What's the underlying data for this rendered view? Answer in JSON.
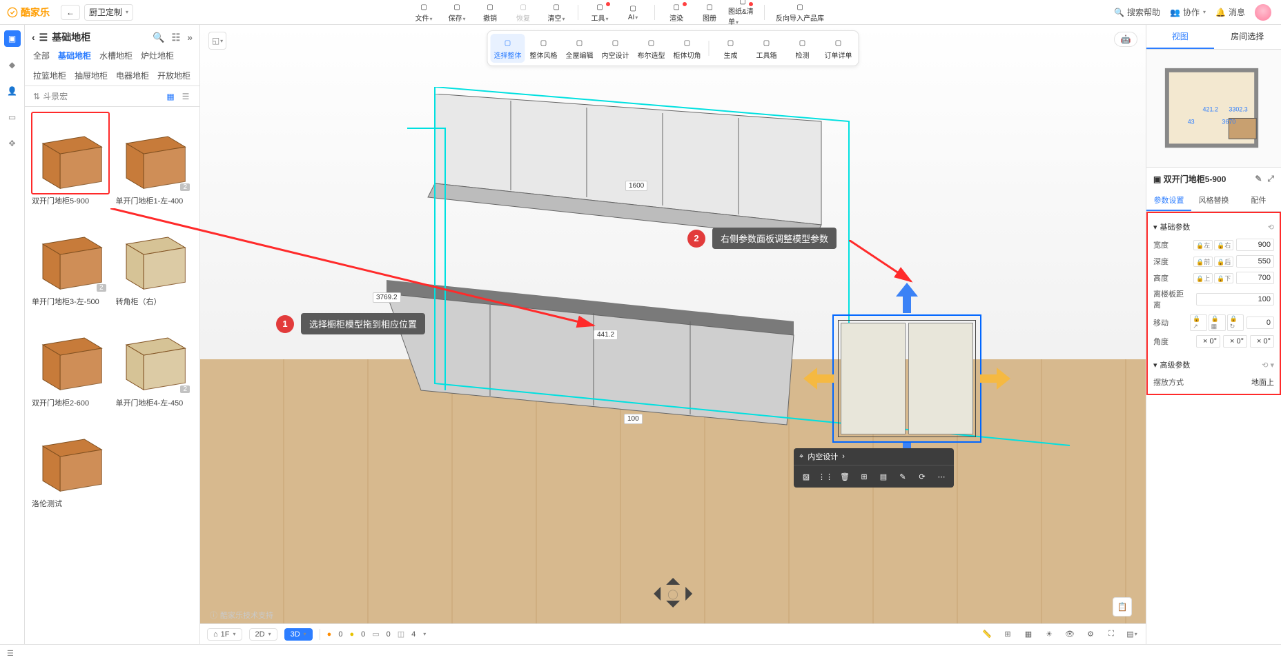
{
  "brand": "酷家乐",
  "mode": "厨卫定制",
  "top_tools": [
    {
      "id": "file",
      "label": "文件",
      "dot": false,
      "caret": true
    },
    {
      "id": "save",
      "label": "保存",
      "dot": false,
      "caret": true
    },
    {
      "id": "undo",
      "label": "撤销",
      "dot": false
    },
    {
      "id": "redo",
      "label": "恢复",
      "dot": false,
      "disabled": true
    },
    {
      "id": "clear",
      "label": "清空",
      "dot": false,
      "caret": true
    },
    {
      "id": "div",
      "label": "",
      "divider": true
    },
    {
      "id": "tools",
      "label": "工具",
      "dot": true,
      "caret": true
    },
    {
      "id": "ai",
      "label": "AI",
      "dot": false,
      "caret": true
    },
    {
      "id": "div2",
      "label": "",
      "divider": true
    },
    {
      "id": "render",
      "label": "渲染",
      "dot": true
    },
    {
      "id": "album",
      "label": "图册",
      "dot": false
    },
    {
      "id": "draw",
      "label": "图纸&清单",
      "dot": true,
      "caret": true
    },
    {
      "id": "div3",
      "label": "",
      "divider": true
    },
    {
      "id": "export",
      "label": "反向导入产品库",
      "dot": false,
      "wide": true
    }
  ],
  "top_right": {
    "search": "搜索帮助",
    "collab": "协作",
    "msg": "消息"
  },
  "rail": [
    "home",
    "deco",
    "user",
    "box",
    "puzzle"
  ],
  "catalog": {
    "title": "基础地柜",
    "tabs_row1": [
      "全部",
      "基础地柜",
      "水槽地柜",
      "炉灶地柜"
    ],
    "tabs_row2": [
      "拉篮地柜",
      "抽屉地柜",
      "电器地柜",
      "开放地柜"
    ],
    "active_tab": "基础地柜",
    "filter_label": "斗景宏",
    "items": [
      {
        "name": "双开门地柜5-900",
        "badge": "",
        "sel": true,
        "col": "#c77b3a"
      },
      {
        "name": "单开门地柜1-左-400",
        "badge": "2",
        "col": "#c77b3a"
      },
      {
        "name": "单开门地柜3-左-500",
        "badge": "2",
        "col": "#c77b3a"
      },
      {
        "name": "转角柜（右）",
        "badge": "",
        "col": "#d6c396"
      },
      {
        "name": "双开门地柜2-600",
        "badge": "",
        "col": "#c77b3a"
      },
      {
        "name": "单开门地柜4-左-450",
        "badge": "2",
        "col": "#d6c396"
      },
      {
        "name": "洛伦测试",
        "badge": "",
        "col": "#c77b3a"
      },
      {
        "name": "",
        "badge": "",
        "col": "",
        "empty": true
      }
    ]
  },
  "view_tools": [
    {
      "id": "select",
      "label": "选择整体",
      "active": true
    },
    {
      "id": "style",
      "label": "整体风格"
    },
    {
      "id": "edit",
      "label": "全屋编辑"
    },
    {
      "id": "interior",
      "label": "内空设计"
    },
    {
      "id": "profile",
      "label": "布尔造型"
    },
    {
      "id": "edge",
      "label": "柜体切角"
    },
    {
      "id": "div",
      "divider": true
    },
    {
      "id": "gen",
      "label": "生成"
    },
    {
      "id": "toolbox",
      "label": "工具箱"
    },
    {
      "id": "check",
      "label": "检测"
    },
    {
      "id": "order",
      "label": "订单详单"
    }
  ],
  "dimensions": {
    "wall_h": "1600",
    "counter_w": "3769.2",
    "gap": "441.2",
    "front": "100",
    "mini1": "421.2",
    "mini2": "3302.3",
    "mini3": "43",
    "mini4": "3670"
  },
  "annot": {
    "step1": "选择橱柜模型拖到相应位置",
    "step2": "右侧参数面板调整模型参数"
  },
  "obj_popup": {
    "title": "内空设计"
  },
  "right": {
    "tabs": [
      "视图",
      "房间选择"
    ],
    "active": "视图",
    "obj_title": "双开门地柜5-900",
    "ptabs": [
      "参数设置",
      "风格替换",
      "配件"
    ],
    "pactive": "参数设置",
    "sec1": "基础参数",
    "sec2": "高级参数",
    "rows": [
      {
        "label": "宽度",
        "locks": [
          "左",
          "右"
        ],
        "val": "900"
      },
      {
        "label": "深度",
        "locks": [
          "前",
          "后"
        ],
        "val": "550"
      },
      {
        "label": "高度",
        "locks": [
          "上",
          "下"
        ],
        "val": "700"
      },
      {
        "label": "离楼板距离",
        "locks": [],
        "val": "100"
      },
      {
        "label": "移动",
        "locks": [
          "↗",
          "▦",
          "↻"
        ],
        "val": "0"
      },
      {
        "label": "角度",
        "locks": [],
        "val": "",
        "triple": [
          "0°",
          "0°",
          "0°"
        ]
      }
    ],
    "place_label": "摆放方式",
    "place_val": "地面上"
  },
  "status": {
    "floor": "1F",
    "btn2d": "2D",
    "btn3d": "3D",
    "counters": [
      "0",
      "0",
      "0",
      "4"
    ],
    "wm": "酷家乐技术支持"
  }
}
